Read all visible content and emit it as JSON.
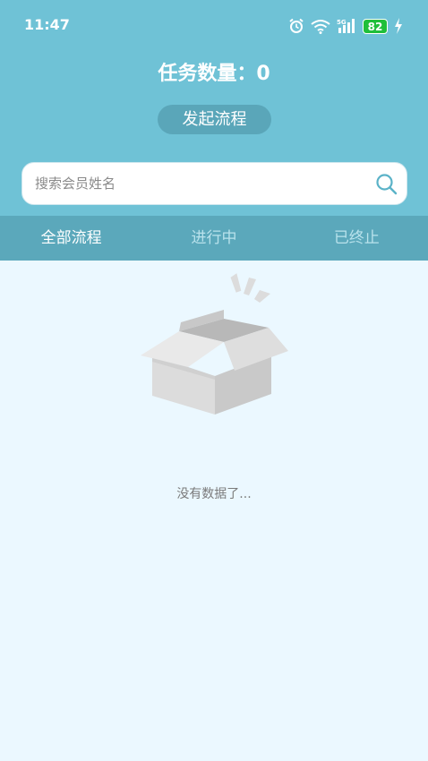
{
  "status_bar": {
    "time": "11:47",
    "battery": "82",
    "icons": [
      "alarm-icon",
      "wifi-icon",
      "5g-signal-icon",
      "battery-icon",
      "charging-icon"
    ]
  },
  "header": {
    "task_count_label": "任务数量：0",
    "start_button": "发起流程"
  },
  "search": {
    "placeholder": "搜索会员姓名",
    "value": ""
  },
  "tabs": [
    {
      "label": "全部流程",
      "active": true
    },
    {
      "label": "进行中",
      "active": false
    },
    {
      "label": "已终止",
      "active": false
    }
  ],
  "empty_state": {
    "text": "没有数据了..."
  },
  "colors": {
    "header_bg": "#6fc2d6",
    "tab_bar_bg": "#5ba8bb",
    "button_bg": "#5aa6b9",
    "page_bg": "#ebf8ff",
    "battery_green": "#1fbf3a"
  }
}
